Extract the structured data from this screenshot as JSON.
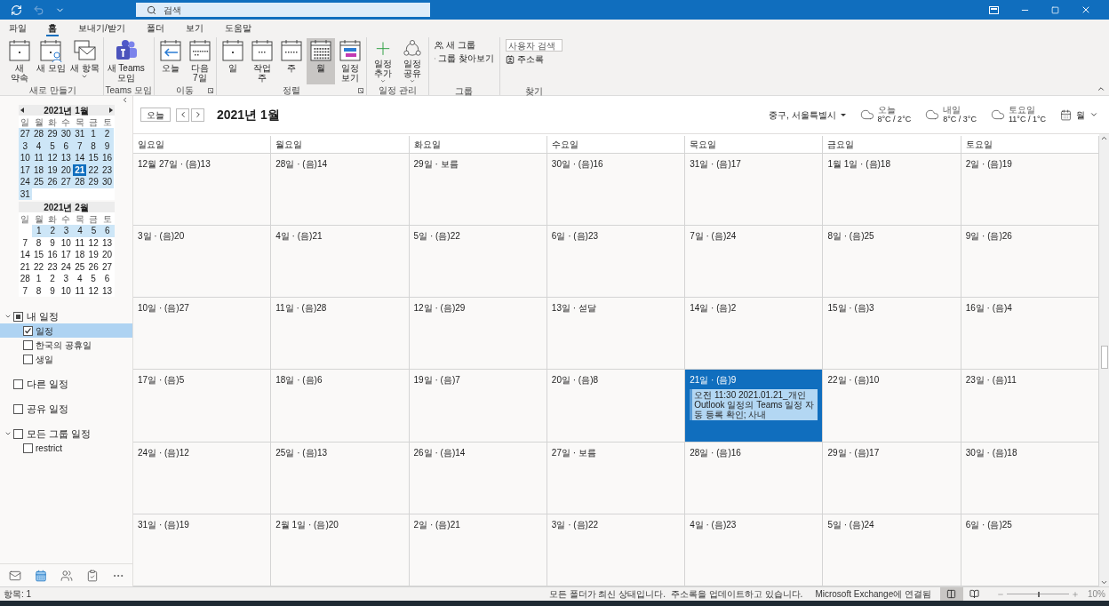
{
  "title_bar": {
    "search": {
      "placeholder": "검색"
    }
  },
  "menu_tabs": [
    {
      "label": "파일",
      "selected": false
    },
    {
      "label": "홈",
      "selected": true
    },
    {
      "label": "보내기/받기",
      "selected": false
    },
    {
      "label": "폴더",
      "selected": false
    },
    {
      "label": "보기",
      "selected": false
    },
    {
      "label": "도움말",
      "selected": false
    }
  ],
  "ribbon": {
    "groups": [
      {
        "label": "새로 만들기",
        "launcher": false,
        "buttons": [
          {
            "lines": [
              "새",
              "약속"
            ],
            "dropdown": false,
            "selected": false
          },
          {
            "lines": [
              "새 모임"
            ],
            "dropdown": false,
            "selected": false
          },
          {
            "lines": [
              "새 항목"
            ],
            "dropdown": true,
            "selected": false
          }
        ]
      },
      {
        "label": "Teams 모임",
        "launcher": false,
        "buttons": [
          {
            "lines": [
              "새 Teams",
              "모임"
            ],
            "dropdown": false,
            "selected": false
          }
        ]
      },
      {
        "label": "이동",
        "launcher": true,
        "buttons": [
          {
            "lines": [
              "오늘"
            ],
            "dropdown": false,
            "selected": false
          },
          {
            "lines": [
              "다음",
              "7일"
            ],
            "dropdown": false,
            "selected": false
          }
        ]
      },
      {
        "label": "정렬",
        "launcher": true,
        "buttons": [
          {
            "lines": [
              "일"
            ],
            "dropdown": false,
            "selected": false
          },
          {
            "lines": [
              "작업",
              "주"
            ],
            "dropdown": false,
            "selected": false
          },
          {
            "lines": [
              "주"
            ],
            "dropdown": false,
            "selected": false
          },
          {
            "lines": [
              "월"
            ],
            "dropdown": false,
            "selected": true
          },
          {
            "lines": [
              "일정",
              "보기"
            ],
            "dropdown": false,
            "selected": false
          }
        ]
      },
      {
        "label": "일정 관리",
        "launcher": false,
        "buttons": [
          {
            "lines": [
              "일정",
              "추가"
            ],
            "dropdown": true,
            "selected": false
          },
          {
            "lines": [
              "일정",
              "공유"
            ],
            "dropdown": true,
            "selected": false
          }
        ]
      }
    ],
    "groups_group": {
      "label": "그룹",
      "buttons": [
        "새 그룹",
        "그룹 찾아보기"
      ]
    },
    "find_group": {
      "label": "찾기",
      "search": {
        "placeholder": "사용자 검색"
      },
      "address_book": "주소록"
    }
  },
  "mini_calendars": [
    {
      "title": "2021년 1월",
      "weekdays": [
        "일",
        "월",
        "화",
        "수",
        "목",
        "금",
        "토"
      ],
      "weeks": [
        {
          "in_view": true,
          "days": [
            {
              "d": "27",
              "selected": false
            },
            {
              "d": "28",
              "selected": false
            },
            {
              "d": "29",
              "selected": false
            },
            {
              "d": "30",
              "selected": false
            },
            {
              "d": "31",
              "selected": false
            },
            {
              "d": "1",
              "selected": false
            },
            {
              "d": "2",
              "selected": false
            }
          ]
        },
        {
          "in_view": true,
          "days": [
            {
              "d": "3",
              "selected": false
            },
            {
              "d": "4",
              "selected": false
            },
            {
              "d": "5",
              "selected": false
            },
            {
              "d": "6",
              "selected": false
            },
            {
              "d": "7",
              "selected": false
            },
            {
              "d": "8",
              "selected": false
            },
            {
              "d": "9",
              "selected": false
            }
          ]
        },
        {
          "in_view": true,
          "days": [
            {
              "d": "10",
              "selected": false
            },
            {
              "d": "11",
              "selected": false
            },
            {
              "d": "12",
              "selected": false
            },
            {
              "d": "13",
              "selected": false
            },
            {
              "d": "14",
              "selected": false
            },
            {
              "d": "15",
              "selected": false
            },
            {
              "d": "16",
              "selected": false
            }
          ]
        },
        {
          "in_view": true,
          "days": [
            {
              "d": "17",
              "selected": false
            },
            {
              "d": "18",
              "selected": false
            },
            {
              "d": "19",
              "selected": false
            },
            {
              "d": "20",
              "selected": false
            },
            {
              "d": "21",
              "selected": true
            },
            {
              "d": "22",
              "selected": false
            },
            {
              "d": "23",
              "selected": false
            }
          ]
        },
        {
          "in_view": true,
          "days": [
            {
              "d": "24",
              "selected": false
            },
            {
              "d": "25",
              "selected": false
            },
            {
              "d": "26",
              "selected": false
            },
            {
              "d": "27",
              "selected": false
            },
            {
              "d": "28",
              "selected": false
            },
            {
              "d": "29",
              "selected": false
            },
            {
              "d": "30",
              "selected": false
            }
          ]
        },
        {
          "in_view": true,
          "days": [
            {
              "d": "31",
              "selected": false
            }
          ]
        }
      ]
    },
    {
      "title": "2021년 2월",
      "weekdays": [
        "일",
        "월",
        "화",
        "수",
        "목",
        "금",
        "토"
      ],
      "weeks": [
        {
          "in_view": true,
          "days": [
            {
              "d": "1",
              "selected": false
            },
            {
              "d": "2",
              "selected": false
            },
            {
              "d": "3",
              "selected": false
            },
            {
              "d": "4",
              "selected": false
            },
            {
              "d": "5",
              "selected": false
            },
            {
              "d": "6",
              "selected": false
            }
          ]
        },
        {
          "in_view": false,
          "days": [
            {
              "d": "7",
              "selected": false
            },
            {
              "d": "8",
              "selected": false
            },
            {
              "d": "9",
              "selected": false
            },
            {
              "d": "10",
              "selected": false
            },
            {
              "d": "11",
              "selected": false
            },
            {
              "d": "12",
              "selected": false
            },
            {
              "d": "13",
              "selected": false
            }
          ]
        },
        {
          "in_view": false,
          "days": [
            {
              "d": "14",
              "selected": false
            },
            {
              "d": "15",
              "selected": false
            },
            {
              "d": "16",
              "selected": false
            },
            {
              "d": "17",
              "selected": false
            },
            {
              "d": "18",
              "selected": false
            },
            {
              "d": "19",
              "selected": false
            },
            {
              "d": "20",
              "selected": false
            }
          ]
        },
        {
          "in_view": false,
          "days": [
            {
              "d": "21",
              "selected": false
            },
            {
              "d": "22",
              "selected": false
            },
            {
              "d": "23",
              "selected": false
            },
            {
              "d": "24",
              "selected": false
            },
            {
              "d": "25",
              "selected": false
            },
            {
              "d": "26",
              "selected": false
            },
            {
              "d": "27",
              "selected": false
            }
          ]
        },
        {
          "in_view": false,
          "days": [
            {
              "d": "28",
              "selected": false
            },
            {
              "d": "1",
              "selected": false
            },
            {
              "d": "2",
              "selected": false
            },
            {
              "d": "3",
              "selected": false
            },
            {
              "d": "4",
              "selected": false
            },
            {
              "d": "5",
              "selected": false
            },
            {
              "d": "6",
              "selected": false
            }
          ]
        },
        {
          "in_view": false,
          "days": [
            {
              "d": "7",
              "selected": false
            },
            {
              "d": "8",
              "selected": false
            },
            {
              "d": "9",
              "selected": false
            },
            {
              "d": "10",
              "selected": false
            },
            {
              "d": "11",
              "selected": false
            },
            {
              "d": "12",
              "selected": false
            },
            {
              "d": "13",
              "selected": false
            }
          ]
        }
      ]
    }
  ],
  "folder_groups": [
    {
      "label": "내 일정",
      "checked": true,
      "partial": true,
      "expanded": true,
      "children": [
        {
          "label": "일정",
          "checked": true,
          "selected": true
        },
        {
          "label": "한국의 공휴일",
          "checked": false,
          "selected": false
        },
        {
          "label": "생일",
          "checked": false,
          "selected": false
        }
      ]
    },
    {
      "label": "다른 일정",
      "checked": false,
      "partial": false
    },
    {
      "label": "공유 일정",
      "checked": false,
      "partial": false
    },
    {
      "label": "모든 그룹 일정",
      "checked": false,
      "partial": false,
      "expanded": true,
      "children": [
        {
          "label": "restrict",
          "checked": false,
          "selected": false
        }
      ]
    }
  ],
  "nav_bar": [
    {
      "selected": false
    },
    {
      "selected": true
    },
    {
      "selected": false
    },
    {
      "selected": false
    },
    {
      "selected": false
    }
  ],
  "calendar_header": {
    "today_button": "오늘",
    "title": "2021년 1월",
    "location": "중구, 서울특별시",
    "weather": [
      {
        "day": "오늘",
        "temp": "8°C / 2°C"
      },
      {
        "day": "내일",
        "temp": "8°C / 3°C"
      },
      {
        "day": "토요일",
        "temp": "11°C / 1°C"
      }
    ],
    "view": "월"
  },
  "month_grid": {
    "weekdays": [
      "일요일",
      "월요일",
      "화요일",
      "수요일",
      "목요일",
      "금요일",
      "토요일"
    ],
    "weeks": [
      [
        {
          "label": "12월 27일 · (음)13",
          "selected": false
        },
        {
          "label": "28일 · (음)14",
          "selected": false
        },
        {
          "label": "29일 · 보름",
          "selected": false
        },
        {
          "label": "30일 · (음)16",
          "selected": false
        },
        {
          "label": "31일 · (음)17",
          "selected": false
        },
        {
          "label": "1월 1일 · (음)18",
          "selected": false
        },
        {
          "label": "2일 · (음)19",
          "selected": false
        }
      ],
      [
        {
          "label": "3일 · (음)20",
          "selected": false
        },
        {
          "label": "4일 · (음)21",
          "selected": false
        },
        {
          "label": "5일 · (음)22",
          "selected": false
        },
        {
          "label": "6일 · (음)23",
          "selected": false
        },
        {
          "label": "7일 · (음)24",
          "selected": false
        },
        {
          "label": "8일 · (음)25",
          "selected": false
        },
        {
          "label": "9일 · (음)26",
          "selected": false
        }
      ],
      [
        {
          "label": "10일 · (음)27",
          "selected": false
        },
        {
          "label": "11일 · (음)28",
          "selected": false
        },
        {
          "label": "12일 · (음)29",
          "selected": false
        },
        {
          "label": "13일 · 섣달",
          "selected": false
        },
        {
          "label": "14일 · (음)2",
          "selected": false
        },
        {
          "label": "15일 · (음)3",
          "selected": false
        },
        {
          "label": "16일 · (음)4",
          "selected": false
        }
      ],
      [
        {
          "label": "17일 · (음)5",
          "selected": false
        },
        {
          "label": "18일 · (음)6",
          "selected": false
        },
        {
          "label": "19일 · (음)7",
          "selected": false
        },
        {
          "label": "20일 · (음)8",
          "selected": false
        },
        {
          "label": "21일 · (음)9",
          "selected": true,
          "events": [
            "오전 11:30 2021.01.21_개인 Outlook 일정의 Teams 일정 자동 등록 확인; 사내"
          ]
        },
        {
          "label": "22일 · (음)10",
          "selected": false
        },
        {
          "label": "23일 · (음)11",
          "selected": false
        }
      ],
      [
        {
          "label": "24일 · (음)12",
          "selected": false
        },
        {
          "label": "25일 · (음)13",
          "selected": false
        },
        {
          "label": "26일 · (음)14",
          "selected": false
        },
        {
          "label": "27일 · 보름",
          "selected": false
        },
        {
          "label": "28일 · (음)16",
          "selected": false
        },
        {
          "label": "29일 · (음)17",
          "selected": false
        },
        {
          "label": "30일 · (음)18",
          "selected": false
        }
      ],
      [
        {
          "label": "31일 · (음)19",
          "selected": false
        },
        {
          "label": "2월 1일 · (음)20",
          "selected": false
        },
        {
          "label": "2일 · (음)21",
          "selected": false
        },
        {
          "label": "3일 · (음)22",
          "selected": false
        },
        {
          "label": "4일 · (음)23",
          "selected": false
        },
        {
          "label": "5일 · (음)24",
          "selected": false
        },
        {
          "label": "6일 · (음)25",
          "selected": false
        }
      ]
    ]
  },
  "status_bar": {
    "items": "항목: 1",
    "sync": "모든 폴더가 최신 상태입니다.",
    "address_book": "주소록을 업데이트하고 있습니다.",
    "connection": "Microsoft Exchange에 연결됨",
    "views": [
      {
        "selected": true
      },
      {
        "selected": false
      }
    ],
    "zoom": {
      "level": 0.5,
      "reading": "10%"
    }
  }
}
